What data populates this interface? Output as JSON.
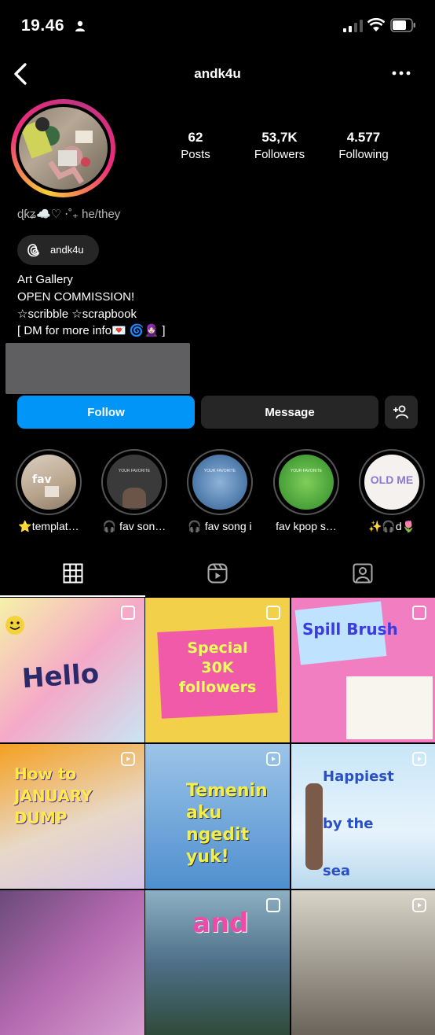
{
  "status_bar": {
    "time": "19.46"
  },
  "header": {
    "username": "andk4u"
  },
  "stats": [
    {
      "value": "62",
      "label": "Posts"
    },
    {
      "value": "53,7K",
      "label": "Followers"
    },
    {
      "value": "4.577",
      "label": "Following"
    }
  ],
  "bio": {
    "name_line": "ɖƙʑ☁️♡ ⋅˚₊ he/they",
    "threads_handle": "andk4u",
    "lines": [
      "Art Gallery",
      "OPEN COMMISSION!",
      "☆scribble ☆scrapbook",
      "[ DM for more info💌 🌀🧕🏻 ]"
    ]
  },
  "actions": {
    "follow": "Follow",
    "message": "Message"
  },
  "highlights": [
    {
      "label": "⭐templat…",
      "cover_text": ""
    },
    {
      "label": "🎧 fav son…",
      "cover_text": "YOUR FAVORITE"
    },
    {
      "label": "🎧 fav song i",
      "cover_text": "YOUR FAVORITE"
    },
    {
      "label": "fav kpop s…",
      "cover_text": "YOUR FAVORITE"
    },
    {
      "label": "✨🎧d🌷",
      "cover_text": "OLD ME"
    }
  ],
  "grid": [
    {
      "text": "Hello"
    },
    {
      "text": "Special 30K followers"
    },
    {
      "text": "Spill Brush"
    },
    {
      "text": "How to JANUARY DUMP"
    },
    {
      "text": "Temenin aku ngedit yuk!"
    },
    {
      "text": "Happiest by the sea"
    },
    {
      "text": ""
    },
    {
      "text": "and"
    },
    {
      "text": ""
    }
  ],
  "colors": {
    "follow": "#0095f6",
    "secondary_button": "#262626"
  }
}
